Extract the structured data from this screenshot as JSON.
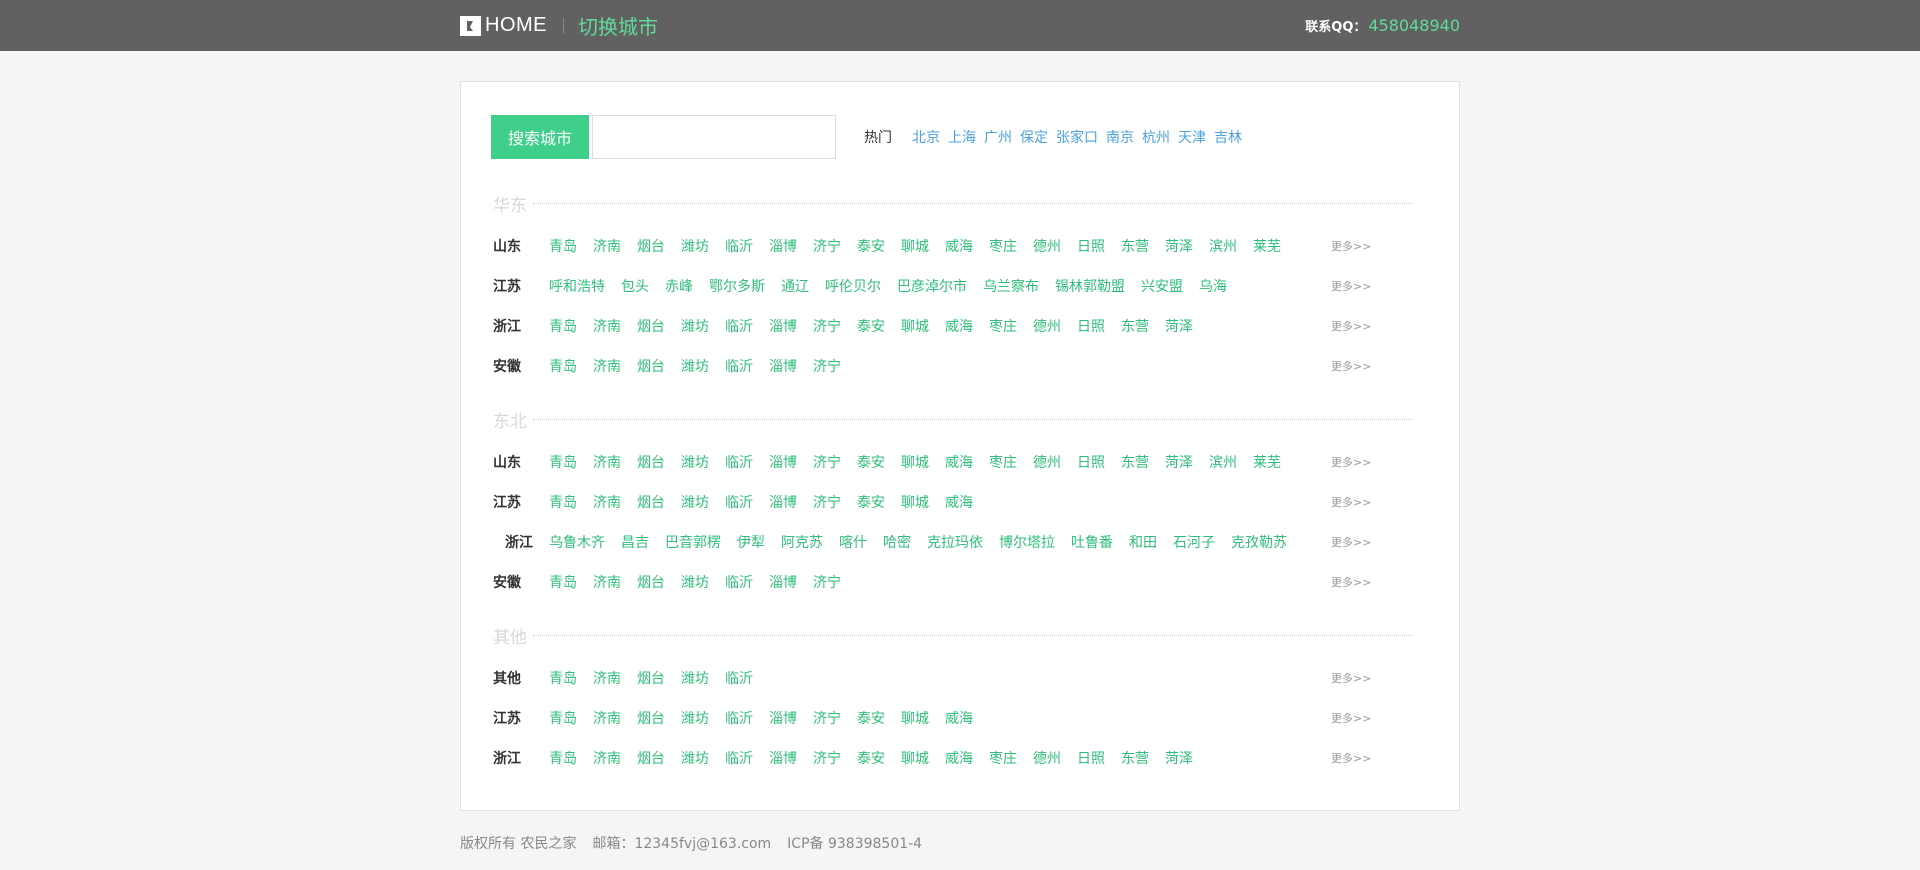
{
  "header": {
    "home_label": "HOME",
    "switch_city": "切换城市",
    "contact_label": "联系QQ：",
    "contact_value": "458048940"
  },
  "search": {
    "button_label": "搜索城市",
    "input_value": "",
    "placeholder": ""
  },
  "hot": {
    "label": "热门",
    "cities": [
      "北京",
      "上海",
      "广州",
      "保定",
      "张家口",
      "南京",
      "杭州",
      "天津",
      "吉林"
    ]
  },
  "more_label": "更多>>",
  "regions": [
    {
      "title": "华东",
      "provinces": [
        {
          "name": "山东",
          "cities": [
            "青岛",
            "济南",
            "烟台",
            "潍坊",
            "临沂",
            "淄博",
            "济宁",
            "泰安",
            "聊城",
            "威海",
            "枣庄",
            "德州",
            "日照",
            "东营",
            "菏泽",
            "滨州",
            "莱芜"
          ]
        },
        {
          "name": "江苏",
          "cities": [
            "呼和浩特",
            "包头",
            "赤峰",
            "鄂尔多斯",
            "通辽",
            "呼伦贝尔",
            "巴彦淖尔市",
            "乌兰察布",
            "锡林郭勒盟",
            "兴安盟",
            "乌海"
          ]
        },
        {
          "name": "浙江",
          "cities": [
            "青岛",
            "济南",
            "烟台",
            "潍坊",
            "临沂",
            "淄博",
            "济宁",
            "泰安",
            "聊城",
            "威海",
            "枣庄",
            "德州",
            "日照",
            "东营",
            "菏泽"
          ]
        },
        {
          "name": "安徽",
          "cities": [
            "青岛",
            "济南",
            "烟台",
            "潍坊",
            "临沂",
            "淄博",
            "济宁"
          ]
        }
      ]
    },
    {
      "title": "东北",
      "provinces": [
        {
          "name": "山东",
          "cities": [
            "青岛",
            "济南",
            "烟台",
            "潍坊",
            "临沂",
            "淄博",
            "济宁",
            "泰安",
            "聊城",
            "威海",
            "枣庄",
            "德州",
            "日照",
            "东营",
            "菏泽",
            "滨州",
            "莱芜"
          ]
        },
        {
          "name": "江苏",
          "cities": [
            "青岛",
            "济南",
            "烟台",
            "潍坊",
            "临沂",
            "淄博",
            "济宁",
            "泰安",
            "聊城",
            "威海"
          ]
        },
        {
          "name": "浙江",
          "cities": [
            "乌鲁木齐",
            "昌吉",
            "巴音郭楞",
            "伊犁",
            "阿克苏",
            "喀什",
            "哈密",
            "克拉玛依",
            "博尔塔拉",
            "吐鲁番",
            "和田",
            "石河子",
            "克孜勒苏"
          ]
        },
        {
          "name": "安徽",
          "cities": [
            "青岛",
            "济南",
            "烟台",
            "潍坊",
            "临沂",
            "淄博",
            "济宁"
          ]
        }
      ]
    },
    {
      "title": "其他",
      "provinces": [
        {
          "name": "其他",
          "cities": [
            "青岛",
            "济南",
            "烟台",
            "潍坊",
            "临沂"
          ]
        },
        {
          "name": "江苏",
          "cities": [
            "青岛",
            "济南",
            "烟台",
            "潍坊",
            "临沂",
            "淄博",
            "济宁",
            "泰安",
            "聊城",
            "威海"
          ]
        },
        {
          "name": "浙江",
          "cities": [
            "青岛",
            "济南",
            "烟台",
            "潍坊",
            "临沂",
            "淄博",
            "济宁",
            "泰安",
            "聊城",
            "威海",
            "枣庄",
            "德州",
            "日照",
            "东营",
            "菏泽"
          ]
        }
      ]
    }
  ],
  "footer": {
    "copyright": "版权所有 农民之家",
    "email": "邮箱：12345fvj@163.com",
    "icp": "ICP备 938398501-4"
  },
  "colors": {
    "topbar": "#616161",
    "accent": "#3fcf8a",
    "city_link": "#2fbf7a",
    "hot_link": "#4aa3df"
  }
}
